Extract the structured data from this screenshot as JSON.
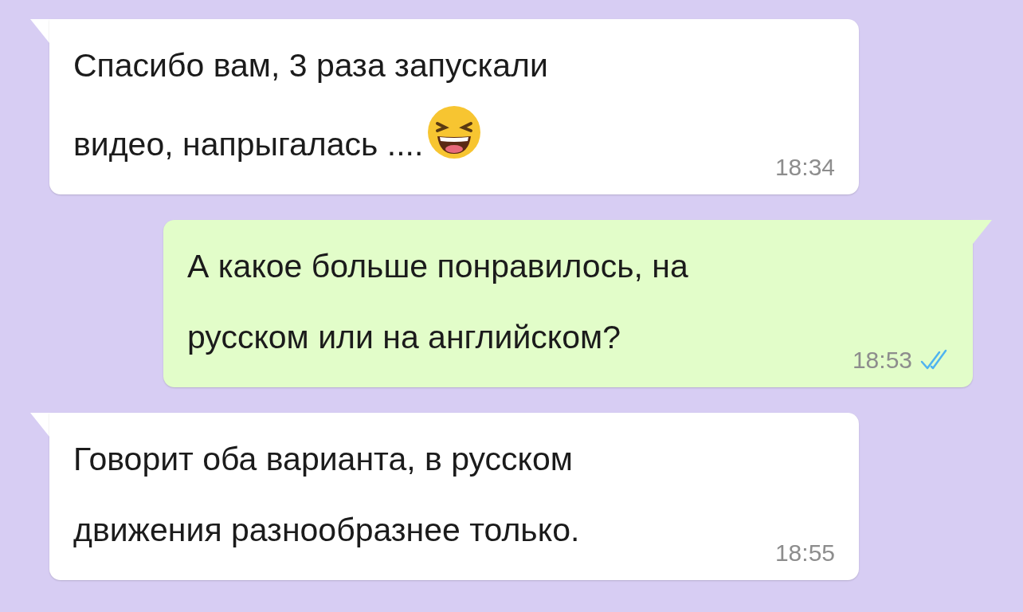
{
  "messages": [
    {
      "outgoing": false,
      "text": "Спасибо вам, 3 раза запускали\nвидео, напрыгалась ....",
      "emoji": true,
      "time": "18:34"
    },
    {
      "outgoing": true,
      "text": "А какое больше понравилось, на\nрусском или на английском?",
      "emoji": false,
      "time": "18:53",
      "read": true
    },
    {
      "outgoing": false,
      "text": "Говорит оба варианта, в русском\nдвижения разнообразнее только.",
      "emoji": false,
      "time": "18:55"
    }
  ]
}
